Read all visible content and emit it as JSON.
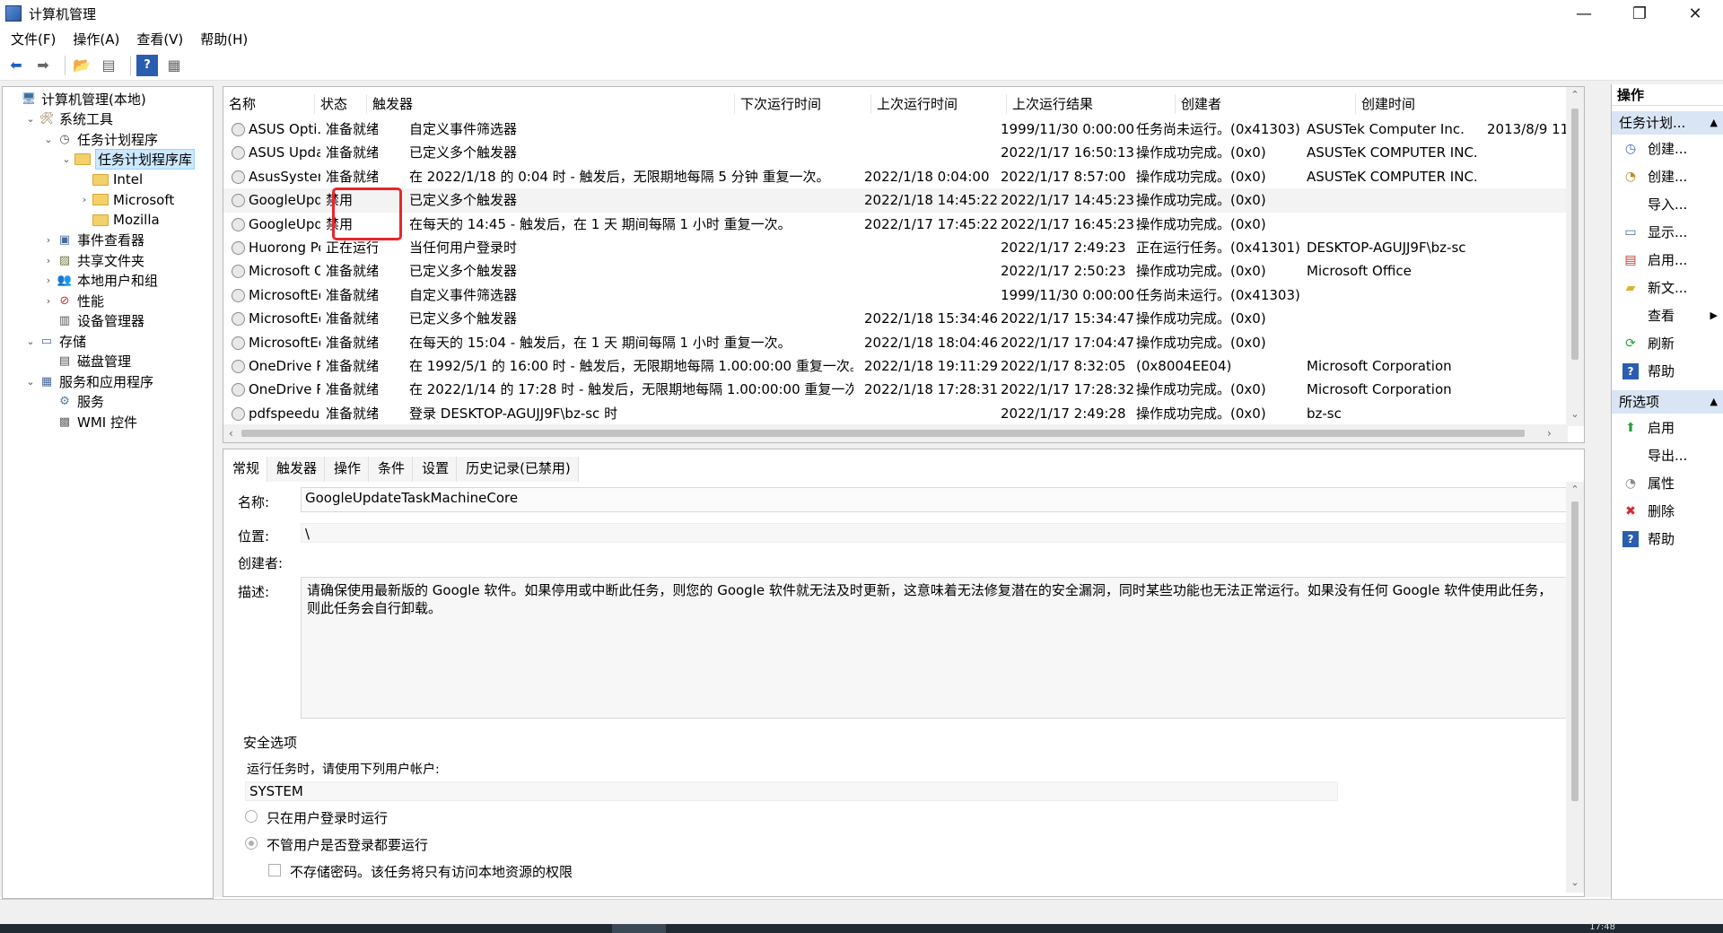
{
  "window": {
    "title": "计算机管理",
    "controls": {
      "minimize": "—",
      "maximize": "❐",
      "close": "✕"
    }
  },
  "menu": [
    "文件(F)",
    "操作(A)",
    "查看(V)",
    "帮助(H)"
  ],
  "toolbar_icons": [
    "back-arrow-icon",
    "forward-arrow-icon",
    "up-folder-icon",
    "show-hide-tree-icon",
    "help-icon",
    "console-icon"
  ],
  "tree": [
    {
      "label": "计算机管理(本地)",
      "level": 0,
      "expander": "",
      "icon": "computer-icon"
    },
    {
      "label": "系统工具",
      "level": 1,
      "expander": "⌄",
      "icon": "tools-icon"
    },
    {
      "label": "任务计划程序",
      "level": 2,
      "expander": "⌄",
      "icon": "clock-icon"
    },
    {
      "label": "任务计划程序库",
      "level": 3,
      "expander": "⌄",
      "icon": "folder-icon",
      "selected": true
    },
    {
      "label": "Intel",
      "level": 4,
      "expander": "",
      "icon": "folder-icon"
    },
    {
      "label": "Microsoft",
      "level": 4,
      "expander": "›",
      "icon": "folder-icon"
    },
    {
      "label": "Mozilla",
      "level": 4,
      "expander": "",
      "icon": "folder-icon"
    },
    {
      "label": "事件查看器",
      "level": 2,
      "expander": "›",
      "icon": "event-viewer-icon"
    },
    {
      "label": "共享文件夹",
      "level": 2,
      "expander": "›",
      "icon": "shared-folder-icon"
    },
    {
      "label": "本地用户和组",
      "level": 2,
      "expander": "›",
      "icon": "users-icon"
    },
    {
      "label": "性能",
      "level": 2,
      "expander": "›",
      "icon": "performance-icon"
    },
    {
      "label": "设备管理器",
      "level": 2,
      "expander": "",
      "icon": "device-manager-icon"
    },
    {
      "label": "存储",
      "level": 1,
      "expander": "⌄",
      "icon": "storage-icon"
    },
    {
      "label": "磁盘管理",
      "level": 2,
      "expander": "",
      "icon": "disk-icon"
    },
    {
      "label": "服务和应用程序",
      "level": 1,
      "expander": "⌄",
      "icon": "services-apps-icon"
    },
    {
      "label": "服务",
      "level": 2,
      "expander": "",
      "icon": "gear-icon"
    },
    {
      "label": "WMI 控件",
      "level": 2,
      "expander": "",
      "icon": "wmi-icon"
    }
  ],
  "task_list": {
    "columns": [
      "名称",
      "状态",
      "触发器",
      "下次运行时间",
      "上次运行时间",
      "上次运行结果",
      "创建者",
      "创建时间"
    ],
    "rows": [
      {
        "name": "ASUS Opti...",
        "status": "准备就绪",
        "trigger": "自定义事件筛选器",
        "next": "",
        "last": "1999/11/30 0:00:00",
        "result": "任务尚未运行。(0x41303)",
        "author": "ASUSTek Computer Inc.",
        "created": "2013/8/9 11:"
      },
      {
        "name": "ASUS Updat...",
        "status": "准备就绪",
        "trigger": "已定义多个触发器",
        "next": "",
        "last": "2022/1/17 16:50:13",
        "result": "操作成功完成。(0x0)",
        "author": "ASUSTeK COMPUTER INC.",
        "created": ""
      },
      {
        "name": "AsusSystem...",
        "status": "准备就绪",
        "trigger": "在 2022/1/18 的 0:04 时 - 触发后，无限期地每隔 5 分钟 重复一次。",
        "next": "2022/1/18 0:04:00",
        "last": "2022/1/17 8:57:00",
        "result": "操作成功完成。(0x0)",
        "author": "ASUSTeK COMPUTER INC.",
        "created": ""
      },
      {
        "name": "GoogleUpd...",
        "status": "禁用",
        "trigger": "已定义多个触发器",
        "next": "2022/1/18 14:45:22",
        "last": "2022/1/17 14:45:23",
        "result": "操作成功完成。(0x0)",
        "author": "",
        "created": "",
        "highlight": true
      },
      {
        "name": "GoogleUpd...",
        "status": "禁用",
        "trigger": "在每天的 14:45 - 触发后，在 1 天 期间每隔 1 小时 重复一次。",
        "next": "2022/1/17 17:45:22",
        "last": "2022/1/17 16:45:23",
        "result": "操作成功完成。(0x0)",
        "author": "",
        "created": ""
      },
      {
        "name": "Huorong Po...",
        "status": "正在运行",
        "trigger": "当任何用户登录时",
        "next": "",
        "last": "2022/1/17 2:49:23",
        "result": "正在运行任务。(0x41301)",
        "author": "DESKTOP-AGUJJ9F\\bz-sc",
        "created": ""
      },
      {
        "name": "Microsoft O...",
        "status": "准备就绪",
        "trigger": "已定义多个触发器",
        "next": "",
        "last": "2022/1/17 2:50:23",
        "result": "操作成功完成。(0x0)",
        "author": "Microsoft Office",
        "created": ""
      },
      {
        "name": "MicrosoftEd...",
        "status": "准备就绪",
        "trigger": "自定义事件筛选器",
        "next": "",
        "last": "1999/11/30 0:00:00",
        "result": "任务尚未运行。(0x41303)",
        "author": "",
        "created": ""
      },
      {
        "name": "MicrosoftEd...",
        "status": "准备就绪",
        "trigger": "已定义多个触发器",
        "next": "2022/1/18 15:34:46",
        "last": "2022/1/17 15:34:47",
        "result": "操作成功完成。(0x0)",
        "author": "",
        "created": ""
      },
      {
        "name": "MicrosoftEd...",
        "status": "准备就绪",
        "trigger": "在每天的 15:04 - 触发后，在 1 天 期间每隔 1 小时 重复一次。",
        "next": "2022/1/18 18:04:46",
        "last": "2022/1/17 17:04:47",
        "result": "操作成功完成。(0x0)",
        "author": "",
        "created": ""
      },
      {
        "name": "OneDrive P...",
        "status": "准备就绪",
        "trigger": "在 1992/5/1 的 16:00 时 - 触发后，无限期地每隔 1.00:00:00 重复一次。",
        "next": "2022/1/18 19:11:29",
        "last": "2022/1/17 8:32:05",
        "result": "(0x8004EE04)",
        "author": "Microsoft Corporation",
        "created": ""
      },
      {
        "name": "OneDrive R...",
        "status": "准备就绪",
        "trigger": "在 2022/1/14 的 17:28 时 - 触发后，无限期地每隔 1.00:00:00 重复一次。",
        "next": "2022/1/18 17:28:31",
        "last": "2022/1/17 17:28:32",
        "result": "操作成功完成。(0x0)",
        "author": "Microsoft Corporation",
        "created": ""
      },
      {
        "name": "pdfspeedup",
        "status": "准备就绪",
        "trigger": "登录 DESKTOP-AGUJJ9F\\bz-sc 时",
        "next": "",
        "last": "2022/1/17 2:49:28",
        "result": "操作成功完成。(0x0)",
        "author": "bz-sc",
        "created": ""
      }
    ]
  },
  "detail": {
    "tabs": [
      "常规",
      "触发器",
      "操作",
      "条件",
      "设置",
      "历史记录(已禁用)"
    ],
    "name_label": "名称:",
    "name_value": "GoogleUpdateTaskMachineCore",
    "location_label": "位置:",
    "location_value": "\\",
    "author_label": "创建者:",
    "author_value": "",
    "desc_label": "描述:",
    "desc_value": "请确保使用最新版的 Google 软件。如果停用或中断此任务，则您的 Google 软件就无法及时更新，这意味着无法修复潜在的安全漏洞，同时某些功能也无法正常运行。如果没有任何 Google 软件使用此任务，则此任务会自行卸载。",
    "security_title": "安全选项",
    "run_as_label": "运行任务时，请使用下列用户帐户:",
    "run_as_value": "SYSTEM",
    "radio1": "只在用户登录时运行",
    "radio2": "不管用户是否登录都要运行",
    "checkbox1": "不存储密码。该任务将只有访问本地资源的权限"
  },
  "actions": {
    "header": "操作",
    "section1": "任务计划...",
    "items1": [
      {
        "label": "创建...",
        "icon": "create-basic-task-icon"
      },
      {
        "label": "创建...",
        "icon": "create-task-icon"
      },
      {
        "label": "导入...",
        "icon": "import-icon"
      },
      {
        "label": "显示...",
        "icon": "display-running-icon"
      },
      {
        "label": "启用...",
        "icon": "enable-history-icon"
      },
      {
        "label": "新文...",
        "icon": "new-folder-icon"
      },
      {
        "label": "查看",
        "icon": "view-icon",
        "submenu": "▶"
      },
      {
        "label": "刷新",
        "icon": "refresh-icon"
      },
      {
        "label": "帮助",
        "icon": "help-icon"
      }
    ],
    "section2": "所选项",
    "items2": [
      {
        "label": "启用",
        "icon": "enable-arrow-icon"
      },
      {
        "label": "导出...",
        "icon": "export-icon"
      },
      {
        "label": "属性",
        "icon": "properties-icon"
      },
      {
        "label": "删除",
        "icon": "delete-icon"
      },
      {
        "label": "帮助",
        "icon": "help-icon"
      }
    ]
  },
  "taskbar": {
    "clock": "17:48"
  }
}
